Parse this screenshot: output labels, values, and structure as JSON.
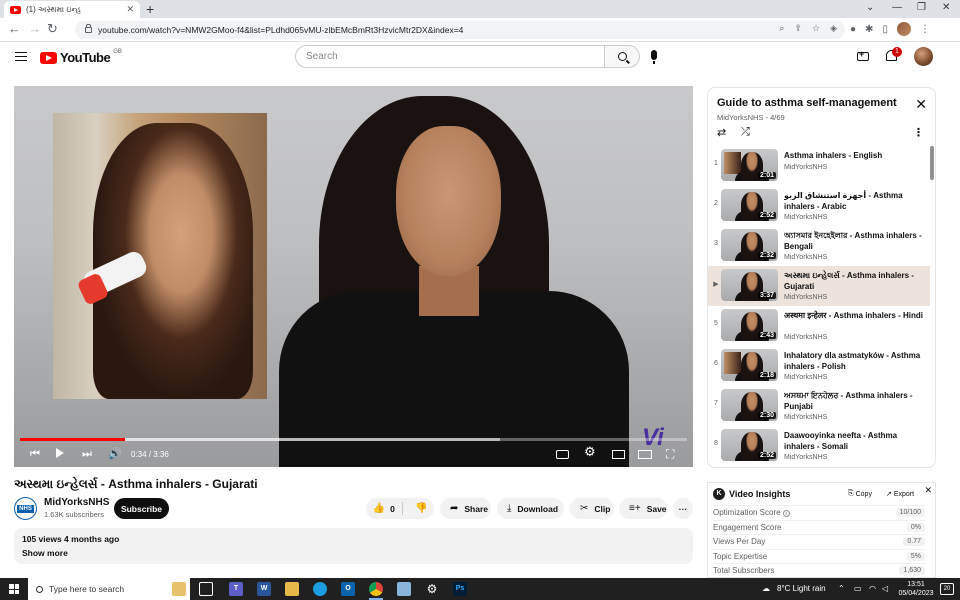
{
  "browser": {
    "tab_title": "(1) અસ્થમા ઇન્હ",
    "url": "youtube.com/watch?v=NMW2GMoo-f4&list=PLdhd065vMU-zlbEMcBmRt3HzvicMtr2DX&index=4"
  },
  "header": {
    "logo_text": "YouTube",
    "country": "GB",
    "search_placeholder": "Search",
    "notification_count": "1"
  },
  "player": {
    "time": "0:34 / 3:36",
    "played_fraction": 0.157,
    "buffered_fraction": 0.72,
    "watermark": "Vi"
  },
  "video": {
    "title": "અસ્થમા ઇન્હેલર્સ - Asthma inhalers - Gujarati",
    "channel_logo": "NHS",
    "channel_name": "MidYorksNHS",
    "channel_subs": "1.63K subscribers",
    "subscribe_label": "Subscribe",
    "like_count": "0",
    "share_label": "Share",
    "download_label": "Download",
    "clip_label": "Clip",
    "save_label": "Save",
    "views_date": "105 views  4 months ago",
    "show_more": "Show more"
  },
  "playlist": {
    "title": "Guide to asthma self-management",
    "subtitle": "MidYorksNHS - 4/69",
    "items": [
      {
        "index": "1",
        "title": "Asthma inhalers - English",
        "channel": "MidYorksNHS",
        "duration": "2:01",
        "active": false,
        "pip": true
      },
      {
        "index": "2",
        "title": "أجهزة استنشاق الربو - Asthma inhalers - Arabic",
        "channel": "MidYorksNHS",
        "duration": "2:52",
        "active": false,
        "pip": false
      },
      {
        "index": "3",
        "title": "অ্যাসমার ইনহেইলার - Asthma inhalers - Bengali",
        "channel": "MidYorksNHS",
        "duration": "2:32",
        "active": false,
        "pip": false
      },
      {
        "index": "▶",
        "title": "અસ્થમા ઇન્હેલર્સ - Asthma inhalers - Gujarati",
        "channel": "MidYorksNHS",
        "duration": "3:37",
        "active": true,
        "pip": false
      },
      {
        "index": "5",
        "title": "अस्थमा इन्हेलर - Asthma inhalers - Hindi",
        "channel": "MidYorksNHS",
        "duration": "2:43",
        "active": false,
        "pip": false
      },
      {
        "index": "6",
        "title": "Inhalatory dla astmatyków - Asthma inhalers - Polish",
        "channel": "MidYorksNHS",
        "duration": "2:18",
        "active": false,
        "pip": true
      },
      {
        "index": "7",
        "title": "ਅਸਥਮਾ ਇਨਹੇਲਰ - Asthma inhalers - Punjabi",
        "channel": "MidYorksNHS",
        "duration": "2:30",
        "active": false,
        "pip": false
      },
      {
        "index": "8",
        "title": "Daawooyinka neefta - Asthma inhalers - Somali",
        "channel": "MidYorksNHS",
        "duration": "2:52",
        "active": false,
        "pip": false
      }
    ]
  },
  "insights": {
    "logo": "K",
    "title": "Video Insights",
    "copy_label": "Copy",
    "export_label": "Export",
    "rows": [
      {
        "label": "Optimization Score",
        "value": "10/100",
        "info": true
      },
      {
        "label": "Engagement Score",
        "value": "0%",
        "info": false
      },
      {
        "label": "Views Per Day",
        "value": "0.77",
        "info": false
      },
      {
        "label": "Topic Expertise",
        "value": "5%",
        "info": false
      },
      {
        "label": "Total Subscribers",
        "value": "1,630",
        "info": false
      }
    ]
  },
  "taskbar": {
    "search_placeholder": "Type here to search",
    "weather": "8°C  Light rain",
    "time": "13:51",
    "date": "05/04/2023",
    "notifications": "20"
  },
  "colors": {
    "youtube_red": "#ff0000",
    "active_row": "#ece3dc",
    "taskbar": "#202020"
  }
}
